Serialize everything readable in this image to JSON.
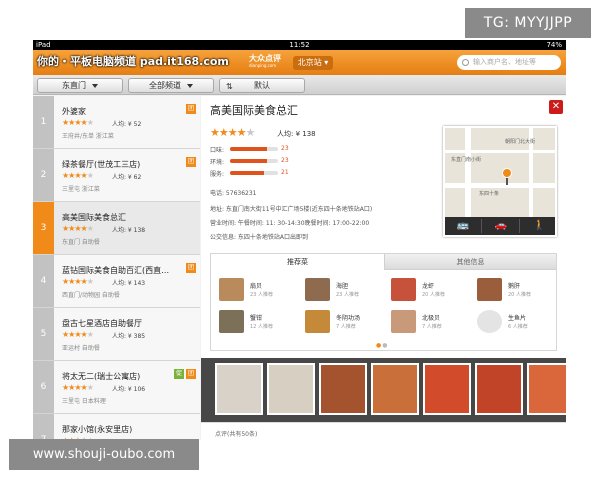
{
  "tag": "TG: MYYJJPP",
  "watermark_bottom": "www.shouji-oubo.com",
  "status": {
    "device": "iPad",
    "time": "11:52",
    "battery": "74%"
  },
  "header": {
    "watermark": "你的・平板电脑频道 pad.it168.com",
    "logo_main": "大众点评",
    "logo_sub": "dianping.com",
    "city": "北京站",
    "search_placeholder": "输入商户名、地址等"
  },
  "filters": {
    "area": "东直门",
    "category": "全部频道",
    "sort": "默认"
  },
  "list": [
    {
      "num": "1",
      "name": "外婆家",
      "avg": "人均: ¥ 52",
      "loc": "王府井/东单  浙江菜",
      "stars": 4,
      "tuan": true,
      "cu": false
    },
    {
      "num": "2",
      "name": "绿茶餐厅(世茂工三店)",
      "avg": "人均: ¥ 62",
      "loc": "三里屯  浙江菜",
      "stars": 4,
      "tuan": true,
      "cu": false
    },
    {
      "num": "3",
      "name": "高美国际美食总汇",
      "avg": "人均: ¥ 138",
      "loc": "东直门  自助餐",
      "stars": 4,
      "tuan": false,
      "cu": false
    },
    {
      "num": "4",
      "name": "蓝钻国际美食自助百汇(西直…",
      "avg": "人均: ¥ 143",
      "loc": "西直门/动物园  自助餐",
      "stars": 4,
      "tuan": true,
      "cu": false
    },
    {
      "num": "5",
      "name": "盘古七星酒店自助餐厅",
      "avg": "人均: ¥ 385",
      "loc": "亚运村  自助餐",
      "stars": 4,
      "tuan": false,
      "cu": false
    },
    {
      "num": "6",
      "name": "将太无二(瑞士公寓店)",
      "avg": "人均: ¥ 106",
      "loc": "三里屯  日本料理",
      "stars": 4,
      "tuan": true,
      "cu": true
    },
    {
      "num": "7",
      "name": "那家小馆(永安里店)",
      "avg": "",
      "loc": "",
      "stars": 4,
      "tuan": false,
      "cu": false
    }
  ],
  "detail": {
    "title": "高美国际美食总汇",
    "avg": "人均: ¥ 138",
    "stars": 4,
    "ratings": [
      {
        "label": "口味:",
        "value": "23",
        "fraction": 0.77
      },
      {
        "label": "环境:",
        "value": "23",
        "fraction": 0.77
      },
      {
        "label": "服务:",
        "value": "21",
        "fraction": 0.7
      }
    ],
    "phone": "电话: 57636231",
    "address": "地址: 东直门南大街11号中汇广场5楼(近东四十条地铁站A口)",
    "hours": "营业时间: 午餐时间: 11: 30-14:30晚餐时间: 17:00-22:00",
    "transit": "公交信息: 东四十条地铁站A口出即到",
    "map_labels": [
      "东直门南小街",
      "东四十条",
      "朝阳门北大街"
    ],
    "tabs": {
      "recommended": "推荐菜",
      "other": "其他信息"
    },
    "dishes": [
      {
        "name": "扇贝",
        "count": "23 人推荐",
        "color": "#b88a5c"
      },
      {
        "name": "海胆",
        "count": "23 人推荐",
        "color": "#8e6b4f"
      },
      {
        "name": "龙虾",
        "count": "20 人推荐",
        "color": "#c7523b"
      },
      {
        "name": "鹅肝",
        "count": "20 人推荐",
        "color": "#9a5e3c"
      },
      {
        "name": "蟹钳",
        "count": "12 人推荐",
        "color": "#7d7058"
      },
      {
        "name": "冬阴功汤",
        "count": "7 人推荐",
        "color": "#c48a3a"
      },
      {
        "name": "北极贝",
        "count": "7 人推荐",
        "color": "#c89a7a"
      },
      {
        "name": "生鱼片",
        "count": "6 人推荐",
        "color": "#e4e4e4"
      }
    ],
    "bottom_text": "点评(共有50条)"
  },
  "photos": [
    {
      "color": "#d9d2c8"
    },
    {
      "color": "#d6cfc2"
    },
    {
      "color": "#a5522f"
    },
    {
      "color": "#c86f3a"
    },
    {
      "color": "#d24b2b"
    },
    {
      "color": "#c24428"
    },
    {
      "color": "#d9673b"
    }
  ],
  "colors": {
    "accent": "#f08a19",
    "close": "#cc1b1b",
    "rating": "#e0531c"
  }
}
